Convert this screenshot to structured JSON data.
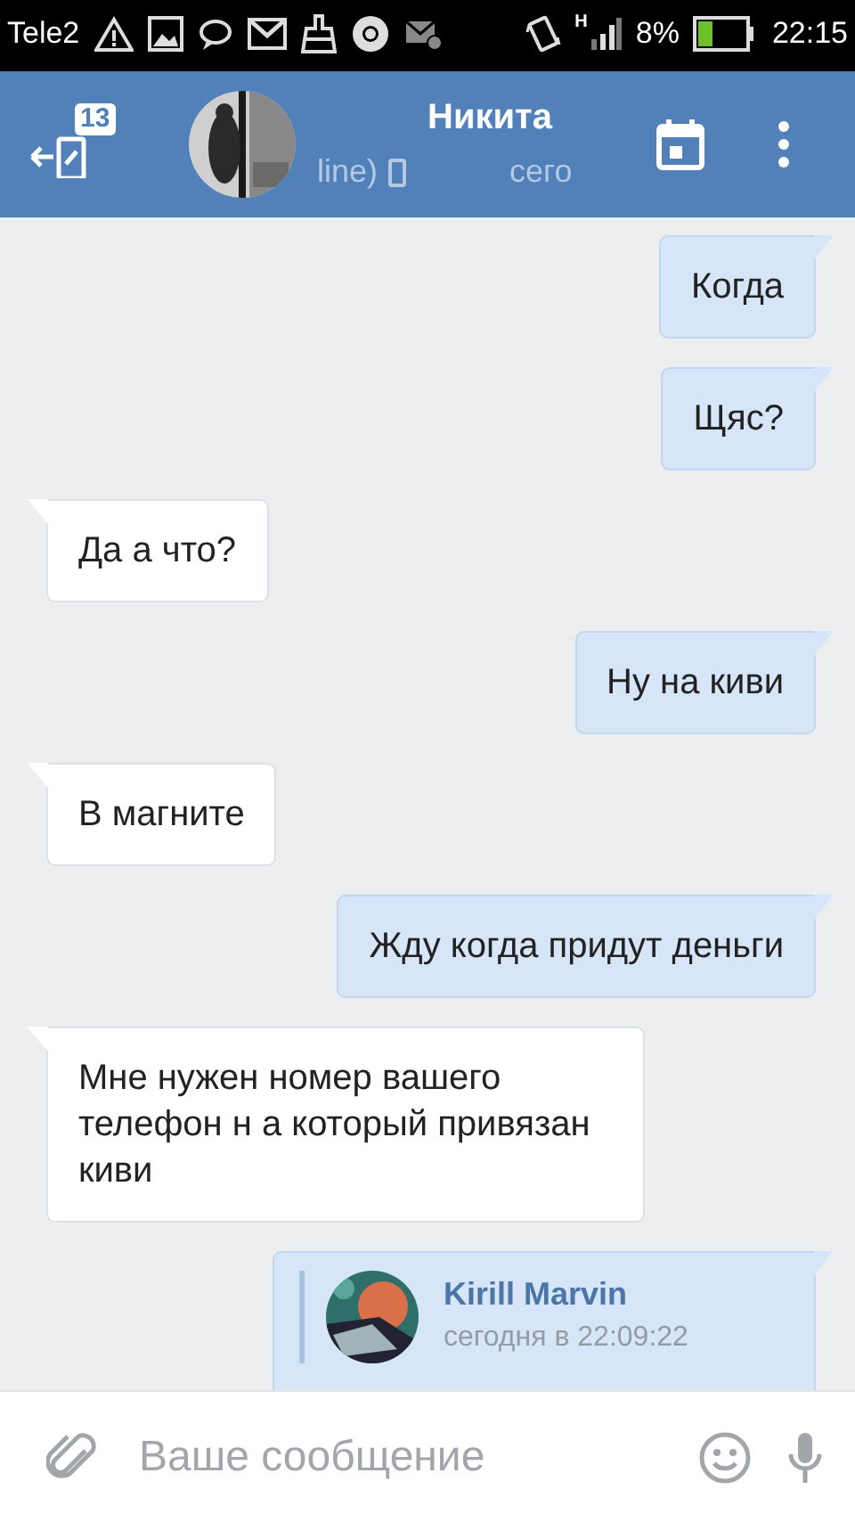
{
  "status_bar": {
    "carrier": "Tele2",
    "network_type": "H",
    "battery_text": "8%",
    "time": "22:15"
  },
  "header": {
    "unread_count": "13",
    "name": "Никита",
    "status": "line)",
    "last_seen": "сего"
  },
  "messages": [
    {
      "kind": "out",
      "text": "Когда"
    },
    {
      "kind": "out",
      "text": "Щяс?"
    },
    {
      "kind": "in",
      "text": "Да а что?"
    },
    {
      "kind": "out",
      "text": "Ну на киви"
    },
    {
      "kind": "in",
      "text": "В магните"
    },
    {
      "kind": "out",
      "text": "Жду когда придут деньги"
    },
    {
      "kind": "in",
      "text": "Мне нужен номер вашего телефон н а который привязан киви"
    },
    {
      "kind": "forward",
      "author": "Kirill Marvin",
      "time": "сегодня в 22:09:22"
    }
  ],
  "composer": {
    "placeholder": "Ваше сообщение"
  }
}
